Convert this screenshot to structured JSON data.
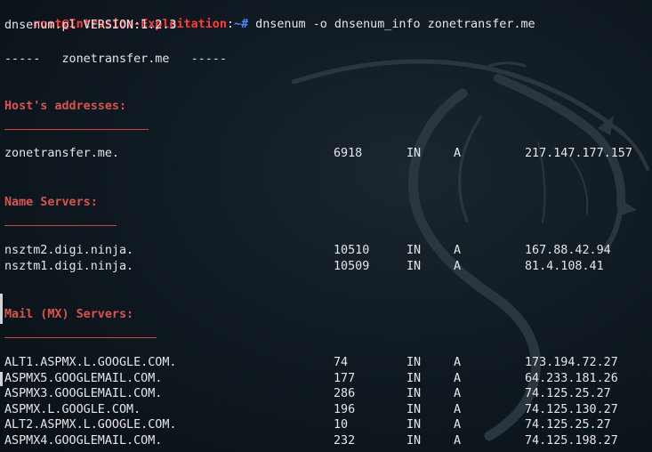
{
  "command_line": {
    "user_host": "root@Intrusion-Exploitation",
    "separator": ":",
    "path": "~#",
    "command": " dnsenum -o dnsenum_info zonetransfer.me"
  },
  "version_line": "dnsenum.pl VERSION:1.2.3",
  "domain_banner": "-----   zonetransfer.me   -----",
  "sections": {
    "hosts": {
      "title": "Host's addresses:",
      "underline": "__________________",
      "rows": [
        {
          "host": "zonetransfer.me.",
          "ttl": "6918",
          "class": "IN",
          "type": "A",
          "ip": "217.147.177.157"
        }
      ]
    },
    "name_servers": {
      "title": "Name Servers:",
      "underline": "______________",
      "rows": [
        {
          "host": "nsztm2.digi.ninja.",
          "ttl": "10510",
          "class": "IN",
          "type": "A",
          "ip": "167.88.42.94"
        },
        {
          "host": "nsztm1.digi.ninja.",
          "ttl": "10509",
          "class": "IN",
          "type": "A",
          "ip": "81.4.108.41"
        }
      ]
    },
    "mx_servers": {
      "title": "Mail (MX) Servers:",
      "underline": "___________________",
      "rows": [
        {
          "host": "ALT1.ASPMX.L.GOOGLE.COM.",
          "ttl": "74",
          "class": "IN",
          "type": "A",
          "ip": "173.194.72.27"
        },
        {
          "host": "ASPMX5.GOOGLEMAIL.COM.",
          "ttl": "177",
          "class": "IN",
          "type": "A",
          "ip": "64.233.181.26"
        },
        {
          "host": "ASPMX3.GOOGLEMAIL.COM.",
          "ttl": "286",
          "class": "IN",
          "type": "A",
          "ip": "74.125.25.27"
        },
        {
          "host": "ASPMX.L.GOOGLE.COM.",
          "ttl": "196",
          "class": "IN",
          "type": "A",
          "ip": "74.125.130.27"
        },
        {
          "host": "ALT2.ASPMX.L.GOOGLE.COM.",
          "ttl": "10",
          "class": "IN",
          "type": "A",
          "ip": "74.125.25.27"
        },
        {
          "host": "ASPMX4.GOOGLEMAIL.COM.",
          "ttl": "232",
          "class": "IN",
          "type": "A",
          "ip": "74.125.198.27"
        }
      ]
    }
  },
  "colors": {
    "background": "#101a22",
    "text": "#e6e6e6",
    "prompt_user": "#ff3b3b",
    "prompt_path": "#4d8bff",
    "section_title": "#d9534f"
  },
  "icons": {
    "background": "kali-dragon-watermark"
  }
}
